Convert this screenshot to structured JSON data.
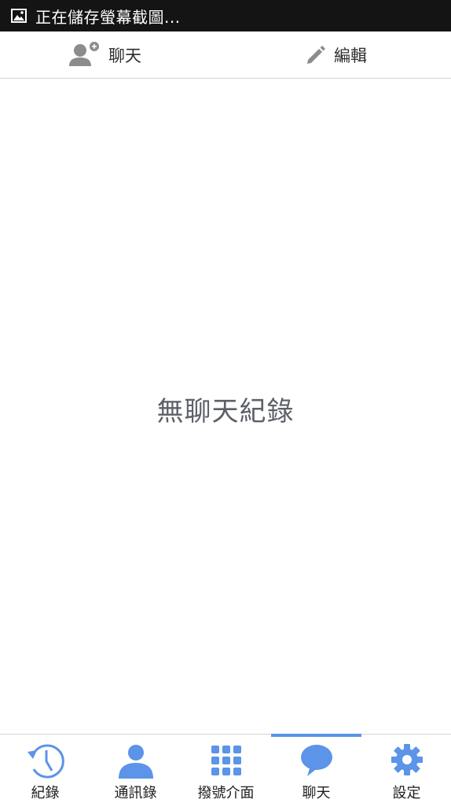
{
  "status_bar": {
    "text": "正在儲存螢幕截圖..."
  },
  "top_actions": {
    "chat_label": "聊天",
    "edit_label": "編輯"
  },
  "empty_message": "無聊天紀錄",
  "tabs": [
    {
      "label": "紀錄",
      "icon": "history-clock-icon"
    },
    {
      "label": "通訊錄",
      "icon": "contacts-person-icon"
    },
    {
      "label": "撥號介面",
      "icon": "dialpad-icon"
    },
    {
      "label": "聊天",
      "icon": "chat-bubble-icon",
      "selected": true
    },
    {
      "label": "設定",
      "icon": "settings-gear-icon"
    }
  ],
  "colors": {
    "accent": "#5b94e8",
    "status_bar": "#141414",
    "icon_gray": "#8c8c8c"
  }
}
